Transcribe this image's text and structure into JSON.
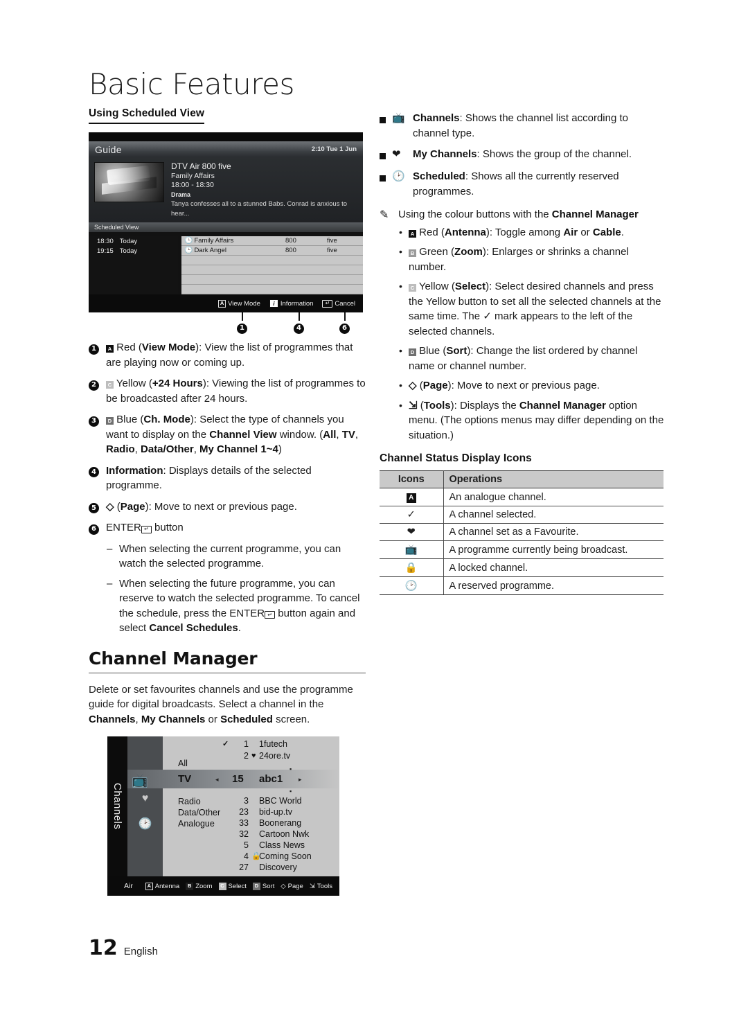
{
  "page": {
    "chapter_title": "Basic Features",
    "footer_page_number": "12",
    "footer_language": "English"
  },
  "left_column": {
    "subhead": "Using Scheduled View",
    "guide_screenshot": {
      "title": "Guide",
      "clock": "2:10 Tue 1 Jun",
      "info": {
        "channel": "DTV Air 800 five",
        "programme": "Family Affairs",
        "time": "18:00 - 18:30",
        "genre": "Drama",
        "description": "Tanya confesses all to a stunned Babs. Conrad is anxious to hear..."
      },
      "section_label": "Scheduled View",
      "rows": [
        {
          "time": "18:30",
          "day": "Today",
          "programme": "Family Affairs",
          "number": "800",
          "channel": "five"
        },
        {
          "time": "19:15",
          "day": "Today",
          "programme": "Dark Angel",
          "number": "800",
          "channel": "five"
        },
        {
          "time": "",
          "day": "",
          "programme": "",
          "number": "",
          "channel": ""
        },
        {
          "time": "",
          "day": "",
          "programme": "",
          "number": "",
          "channel": ""
        },
        {
          "time": "",
          "day": "",
          "programme": "",
          "number": "",
          "channel": ""
        },
        {
          "time": "",
          "day": "",
          "programme": "",
          "number": "",
          "channel": ""
        }
      ],
      "footer_buttons": [
        {
          "key": "A",
          "label": "View Mode"
        },
        {
          "key": "i",
          "label": "Information"
        },
        {
          "key": "return",
          "label": "Cancel"
        }
      ]
    },
    "callouts": [
      "1",
      "4",
      "6"
    ],
    "numbered_items": [
      {
        "n": "1",
        "key": "A",
        "key_color": "red",
        "text_html": "Red (<b>View Mode</b>): View the list of programmes that are playing now or coming up."
      },
      {
        "n": "2",
        "key": "C",
        "key_color": "yellow",
        "text_html": "Yellow (<b>+24 Hours</b>): Viewing the list of programmes to be broadcasted after 24 hours."
      },
      {
        "n": "3",
        "key": "D",
        "key_color": "blue",
        "text_html": "Blue (<b>Ch. Mode</b>): Select the type of channels you want to display on the <b>Channel View</b> window. (<b>All</b>, <b>TV</b>, <b>Radio</b>, <b>Data/Other</b>, <b>My Channel 1~4</b>)"
      },
      {
        "n": "4",
        "key": "",
        "key_color": "",
        "text_html": "<b>Information</b>: Displays details of the selected programme."
      },
      {
        "n": "5",
        "key": "page",
        "key_color": "",
        "text_html": "(<b>Page</b>): Move to next or previous page."
      },
      {
        "n": "6",
        "key": "enter",
        "key_color": "",
        "text_html": "ENTER button"
      }
    ],
    "dash_items": [
      "When selecting the current programme, you can watch the selected programme.",
      "When selecting the future programme, you can reserve to watch the selected programme. To cancel the schedule, press the ENTER button again and select Cancel Schedules."
    ],
    "channel_manager": {
      "heading": "Channel Manager",
      "intro_html": "Delete or set favourites channels and use the programme guide for digital broadcasts. Select a channel in the <b>Channels</b>, <b>My Channels</b> or <b>Scheduled</b> screen.",
      "screenshot": {
        "tab_label": "Channels",
        "categories": [
          "All",
          "TV",
          "Radio",
          "Data/Other",
          "Analogue"
        ],
        "selected_category": "TV",
        "channels": [
          {
            "num": "1",
            "name": "1futech",
            "mark": "check"
          },
          {
            "num": "2",
            "name": "24ore.tv",
            "mark": "heart"
          },
          {
            "num": "15",
            "name": "abc1",
            "mark": "",
            "selected": true
          },
          {
            "num": "3",
            "name": "BBC World",
            "mark": ""
          },
          {
            "num": "23",
            "name": "bid-up.tv",
            "mark": ""
          },
          {
            "num": "33",
            "name": "Boonerang",
            "mark": ""
          },
          {
            "num": "32",
            "name": "Cartoon Nwk",
            "mark": ""
          },
          {
            "num": "5",
            "name": "Class News",
            "mark": ""
          },
          {
            "num": "4",
            "name": "Coming Soon",
            "mark": "lock"
          },
          {
            "num": "27",
            "name": "Discovery",
            "mark": ""
          }
        ],
        "footer_source": "Air",
        "footer_buttons": [
          {
            "key": "A",
            "label": "Antenna"
          },
          {
            "key": "B",
            "label": "Zoom"
          },
          {
            "key": "C",
            "label": "Select"
          },
          {
            "key": "D",
            "label": "Sort"
          },
          {
            "key": "page",
            "label": "Page"
          },
          {
            "key": "tools",
            "label": "Tools"
          }
        ]
      }
    }
  },
  "right_column": {
    "square_items": [
      {
        "icon": "channels-icon",
        "text_html": "<b>Channels</b>: Shows the channel list according to channel type."
      },
      {
        "icon": "heart-icon",
        "text_html": "<b>My Channels</b>: Shows the group of the channel."
      },
      {
        "icon": "clock-icon",
        "text_html": "<b>Scheduled</b>: Shows all the currently reserved programmes."
      }
    ],
    "note_html": "Using the colour buttons with the <b>Channel Manager</b>",
    "bullets": [
      {
        "key": "A",
        "key_color": "red",
        "text_html": "Red (<b>Antenna</b>): Toggle among <b>Air</b> or <b>Cable</b>."
      },
      {
        "key": "B",
        "key_color": "green",
        "text_html": "Green (<b>Zoom</b>): Enlarges or shrinks a channel number."
      },
      {
        "key": "C",
        "key_color": "yellow",
        "text_html": "Yellow (<b>Select</b>): Select desired channels and press the Yellow button to set all the selected channels at the same time. The ✓ mark appears to the left of the selected channels."
      },
      {
        "key": "D",
        "key_color": "blue",
        "text_html": "Blue (<b>Sort</b>): Change the list ordered by channel name or channel number."
      },
      {
        "key": "page",
        "key_color": "",
        "text_html": "(<b>Page</b>): Move to next or previous page."
      },
      {
        "key": "tools",
        "key_color": "",
        "text_html": "(<b>Tools</b>): Displays the <b>Channel Manager</b> option menu. (The options menus may differ depending on the situation.)"
      }
    ],
    "icons_table": {
      "heading": "Channel Status Display Icons",
      "columns": [
        "Icons",
        "Operations"
      ],
      "rows": [
        {
          "icon": "analogue-A",
          "operation": "An analogue channel."
        },
        {
          "icon": "check",
          "operation": "A channel selected."
        },
        {
          "icon": "heart",
          "operation": "A channel set as a Favourite."
        },
        {
          "icon": "tv",
          "operation": "A programme currently being broadcast."
        },
        {
          "icon": "lock",
          "operation": "A locked channel."
        },
        {
          "icon": "clock",
          "operation": "A reserved programme."
        }
      ]
    }
  },
  "colors": {
    "page_bg": "#ffffff",
    "text": "#1f1f1f",
    "rule_grey": "#cfcfcf",
    "tv_dark": "#121212",
    "tv_list_grey": "#c6c6c6"
  }
}
